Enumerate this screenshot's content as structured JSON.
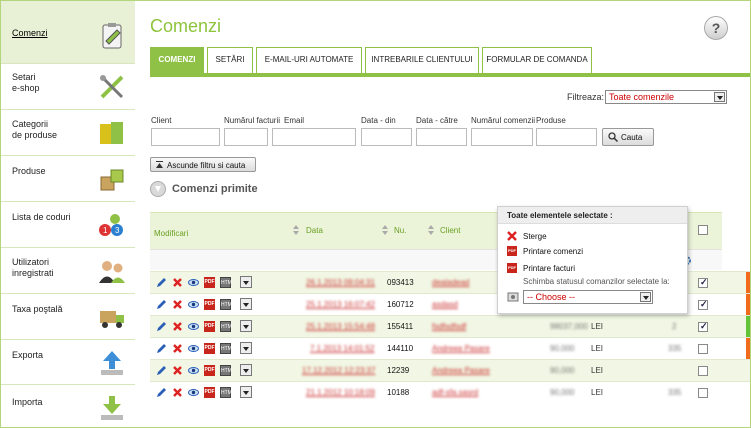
{
  "sidebar": {
    "items": [
      {
        "label": "Comenzi",
        "icon": "clipboard-icon",
        "active": true
      },
      {
        "label": "Setari\ne-shop",
        "icon": "tools-icon"
      },
      {
        "label": "Categorii\nde produse",
        "icon": "folder-icon"
      },
      {
        "label": "Produse",
        "icon": "boxes-icon"
      },
      {
        "label": "Lista de coduri",
        "icon": "numbers-icon"
      },
      {
        "label": "Utilizatori\ninregistrati",
        "icon": "users-icon"
      },
      {
        "label": "Taxa poştală",
        "icon": "truck-icon"
      },
      {
        "label": "Exporta",
        "icon": "upload-icon"
      },
      {
        "label": "Importa",
        "icon": "download-icon"
      }
    ]
  },
  "header": {
    "title": "Comenzi",
    "help": "?"
  },
  "tabs": [
    {
      "label": "COMENZI",
      "active": true
    },
    {
      "label": "SETĂRI"
    },
    {
      "label": "E-MAIL-URI AUTOMATE"
    },
    {
      "label": "INTREBARILE CLIENTULUI"
    },
    {
      "label": "FORMULAR DE COMANDA"
    }
  ],
  "filter": {
    "label": "Filtreaza:",
    "value": "Toate comenzile"
  },
  "search_fields": {
    "client": "Client",
    "invoice_number": "Numărul facturii",
    "email": "Email",
    "date_from": "Data - din",
    "date_to": "Data - către",
    "order_number": "Numărul comenzii",
    "products": "Produse",
    "search_button": "Cauta"
  },
  "collapse_button": "Ascunde filtru si cauta",
  "section_title": "Comenzi primite",
  "table": {
    "headers": {
      "edit": "Modificari",
      "date": "Data",
      "number": "Nu.",
      "client": "Client"
    },
    "rows": [
      {
        "date": "26.1.2013 09:04:31",
        "number": "093413",
        "client": "dealadead",
        "amount": "",
        "currency": "",
        "qty": "",
        "checked": true,
        "status": "#f26a1b"
      },
      {
        "date": "25.1.2013 16:07:42",
        "number": "160712",
        "client": "asdasd",
        "amount": "",
        "currency": "",
        "qty": "",
        "checked": true,
        "status": "#f26a1b"
      },
      {
        "date": "25.1.2013 15:54:48",
        "number": "155411",
        "client": "fsdfsdfsdf",
        "amount": "98037,000",
        "currency": "LEI",
        "qty": "2",
        "checked": true,
        "status": "#63c43a"
      },
      {
        "date": "7.1.2013 14:01:52",
        "number": "144110",
        "client": "Andreea Pasare",
        "amount": "90,000",
        "currency": "LEI",
        "qty": "335",
        "checked": false,
        "status": "#f26a1b"
      },
      {
        "date": "17.12.2012 12:23:37",
        "number": "12239",
        "client": "Andreea Pasare",
        "amount": "90,000",
        "currency": "LEI",
        "qty": "",
        "checked": false,
        "status": ""
      },
      {
        "date": "21.1.2012 10:18:09",
        "number": "10188",
        "client": "adf-sfa.sasrd",
        "amount": "90,000",
        "currency": "LEI",
        "qty": "335",
        "checked": false,
        "status": ""
      }
    ]
  },
  "popup": {
    "title": "Toate elementele selectate :",
    "delete": "Sterge",
    "print_orders": "Printare comenzi",
    "print_invoices": "Printare facturi",
    "status_label": "Schimba statusul comanzilor selectate la:",
    "status_value": "-- Choose --"
  }
}
